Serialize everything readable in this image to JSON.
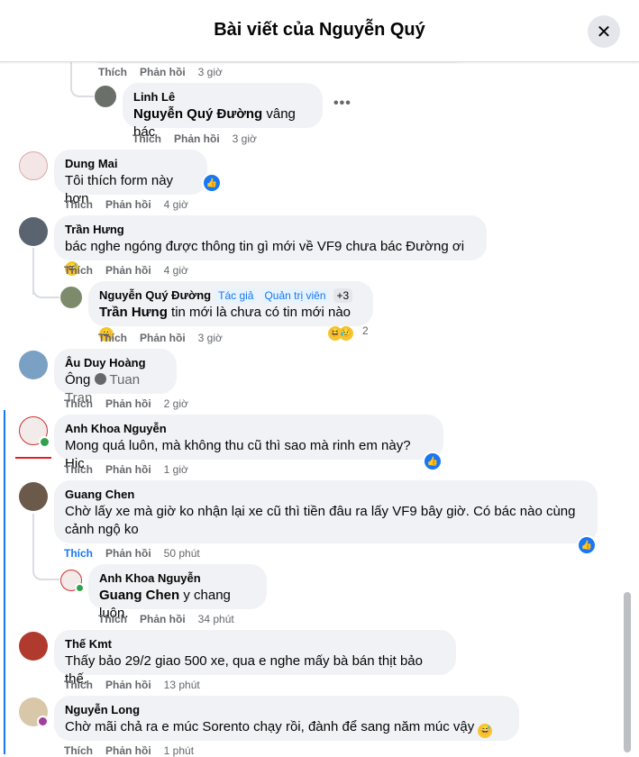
{
  "dialog": {
    "title": "Bài viết của Nguyễn Quý",
    "close_label": "✕"
  },
  "actions": {
    "like": "Thích",
    "reply": "Phản hồi"
  },
  "top_partial": {
    "time": "3 giờ"
  },
  "comments": [
    {
      "name": "Linh Lê",
      "mention": "Nguyễn Quý Đường",
      "text": " vâng bác",
      "time": "3 giờ"
    },
    {
      "name": "Dung Mai",
      "text": "Tôi thích form này hơn",
      "time": "4 giờ"
    },
    {
      "name": "Trần Hưng",
      "text": "bác nghe ngóng được thông tin gì mới về VF9 chưa bác Đường ơi",
      "time": "4 giờ"
    },
    {
      "name": "Nguyễn Quý Đường",
      "badges": [
        "Tác giả",
        "Quản trị viên",
        "+3"
      ],
      "mention": "Trần Hưng",
      "text": " tin mới là chưa có tin mới nào",
      "time": "3 giờ",
      "reaction_count": "2"
    },
    {
      "name": "Âu Duy Hoàng",
      "text_prefix": "Ông",
      "mention": "Tuan Tran",
      "time": "2 giờ"
    },
    {
      "name": "Anh Khoa Nguyễn",
      "text": "Mong quá luôn, mà không thu cũ thì sao mà rinh em này? Hic",
      "time": "1 giờ"
    },
    {
      "name": "Guang Chen",
      "text_line1": "Chờ lấy xe mà giờ ko nhận lại xe cũ thì tiền đâu ra lấy VF9 bây giờ. Có bác nào cùng",
      "text_line2": "cảnh ngộ ko",
      "time": "50 phút"
    },
    {
      "name": "Anh Khoa Nguyễn",
      "mention": "Guang Chen",
      "text": " y chang luôn.",
      "time": "34 phút"
    },
    {
      "name": "Thế Kmt",
      "text": "Thấy bảo 29/2 giao 500 xe, qua e nghe mấy bà bán thịt bảo thế.",
      "time": "13 phút"
    },
    {
      "name": "Nguyễn Long",
      "text": "Chờ mãi chả ra e múc Sorento chạy rồi, đành để sang năm múc vậy",
      "time": "1 phút"
    }
  ],
  "colors": {
    "accent": "#1877f2",
    "bubble": "#f0f2f5",
    "muted": "#65676b"
  }
}
